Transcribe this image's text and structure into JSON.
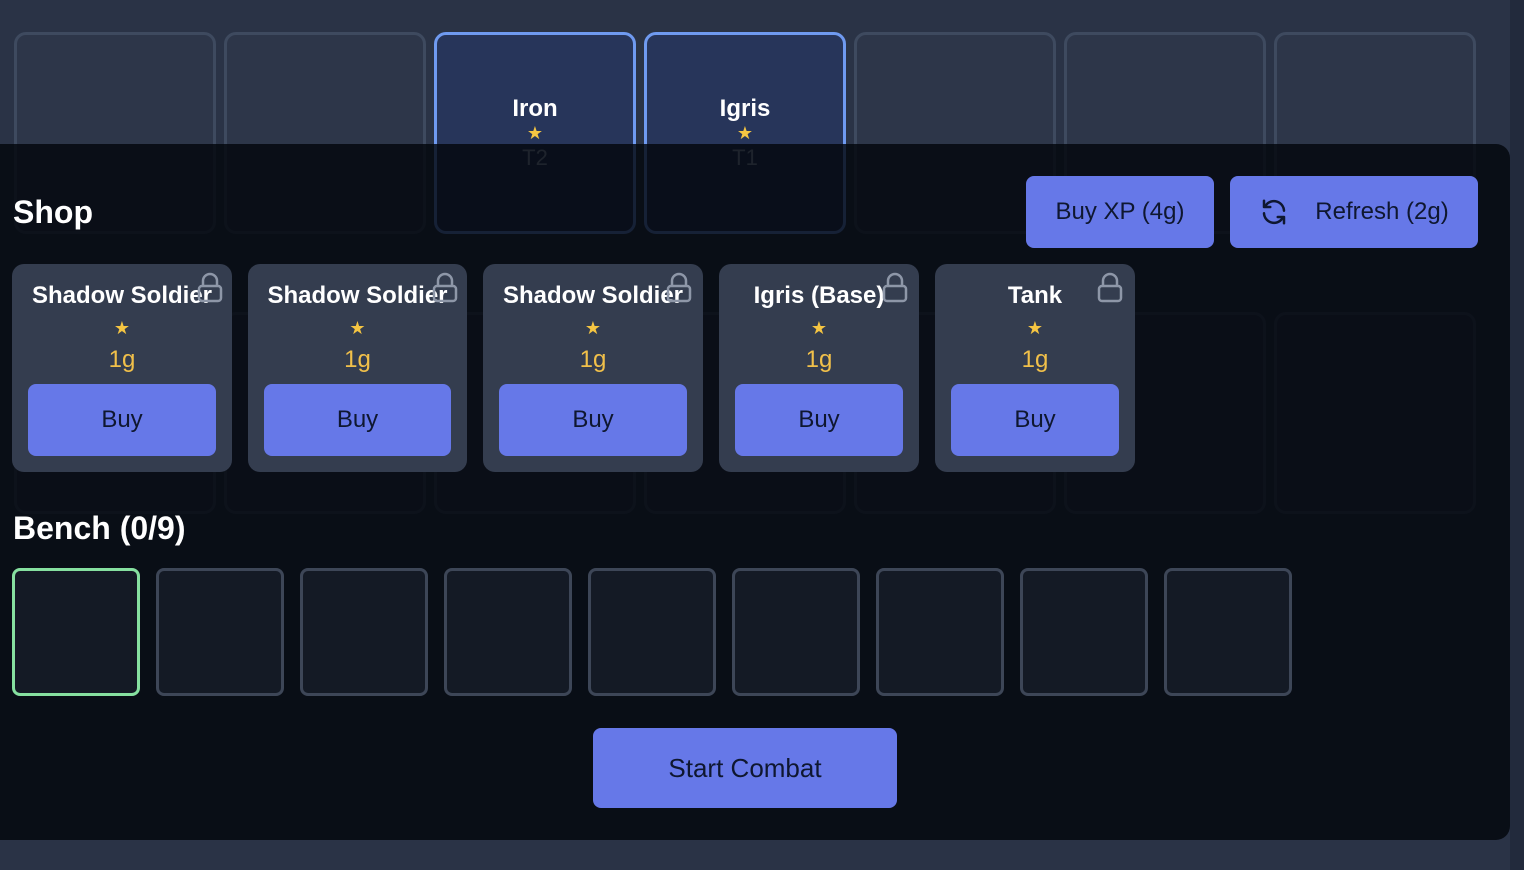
{
  "board": {
    "units": [
      {
        "name": "Iron",
        "stars": "★",
        "tier": "T2"
      },
      {
        "name": "Igris",
        "stars": "★",
        "tier": "T1"
      }
    ]
  },
  "shop": {
    "title": "Shop",
    "buy_xp_label": "Buy XP (4g)",
    "refresh_label": "Refresh (2g)",
    "cards": [
      {
        "name": "Shadow Soldier",
        "stars": "★",
        "cost": "1g",
        "buy_label": "Buy"
      },
      {
        "name": "Shadow Soldier",
        "stars": "★",
        "cost": "1g",
        "buy_label": "Buy"
      },
      {
        "name": "Shadow Soldier",
        "stars": "★",
        "cost": "1g",
        "buy_label": "Buy"
      },
      {
        "name": "Igris (Base)",
        "stars": "★",
        "cost": "1g",
        "buy_label": "Buy"
      },
      {
        "name": "Tank",
        "stars": "★",
        "cost": "1g",
        "buy_label": "Buy"
      }
    ]
  },
  "bench": {
    "title": "Bench (0/9)",
    "selected_slot": 1
  },
  "actions": {
    "start_combat_label": "Start Combat"
  },
  "colors": {
    "accent": "#6678e8",
    "gold": "#f1c04a",
    "selected_border": "#86e0a0",
    "unit_border": "#6f9af0"
  }
}
